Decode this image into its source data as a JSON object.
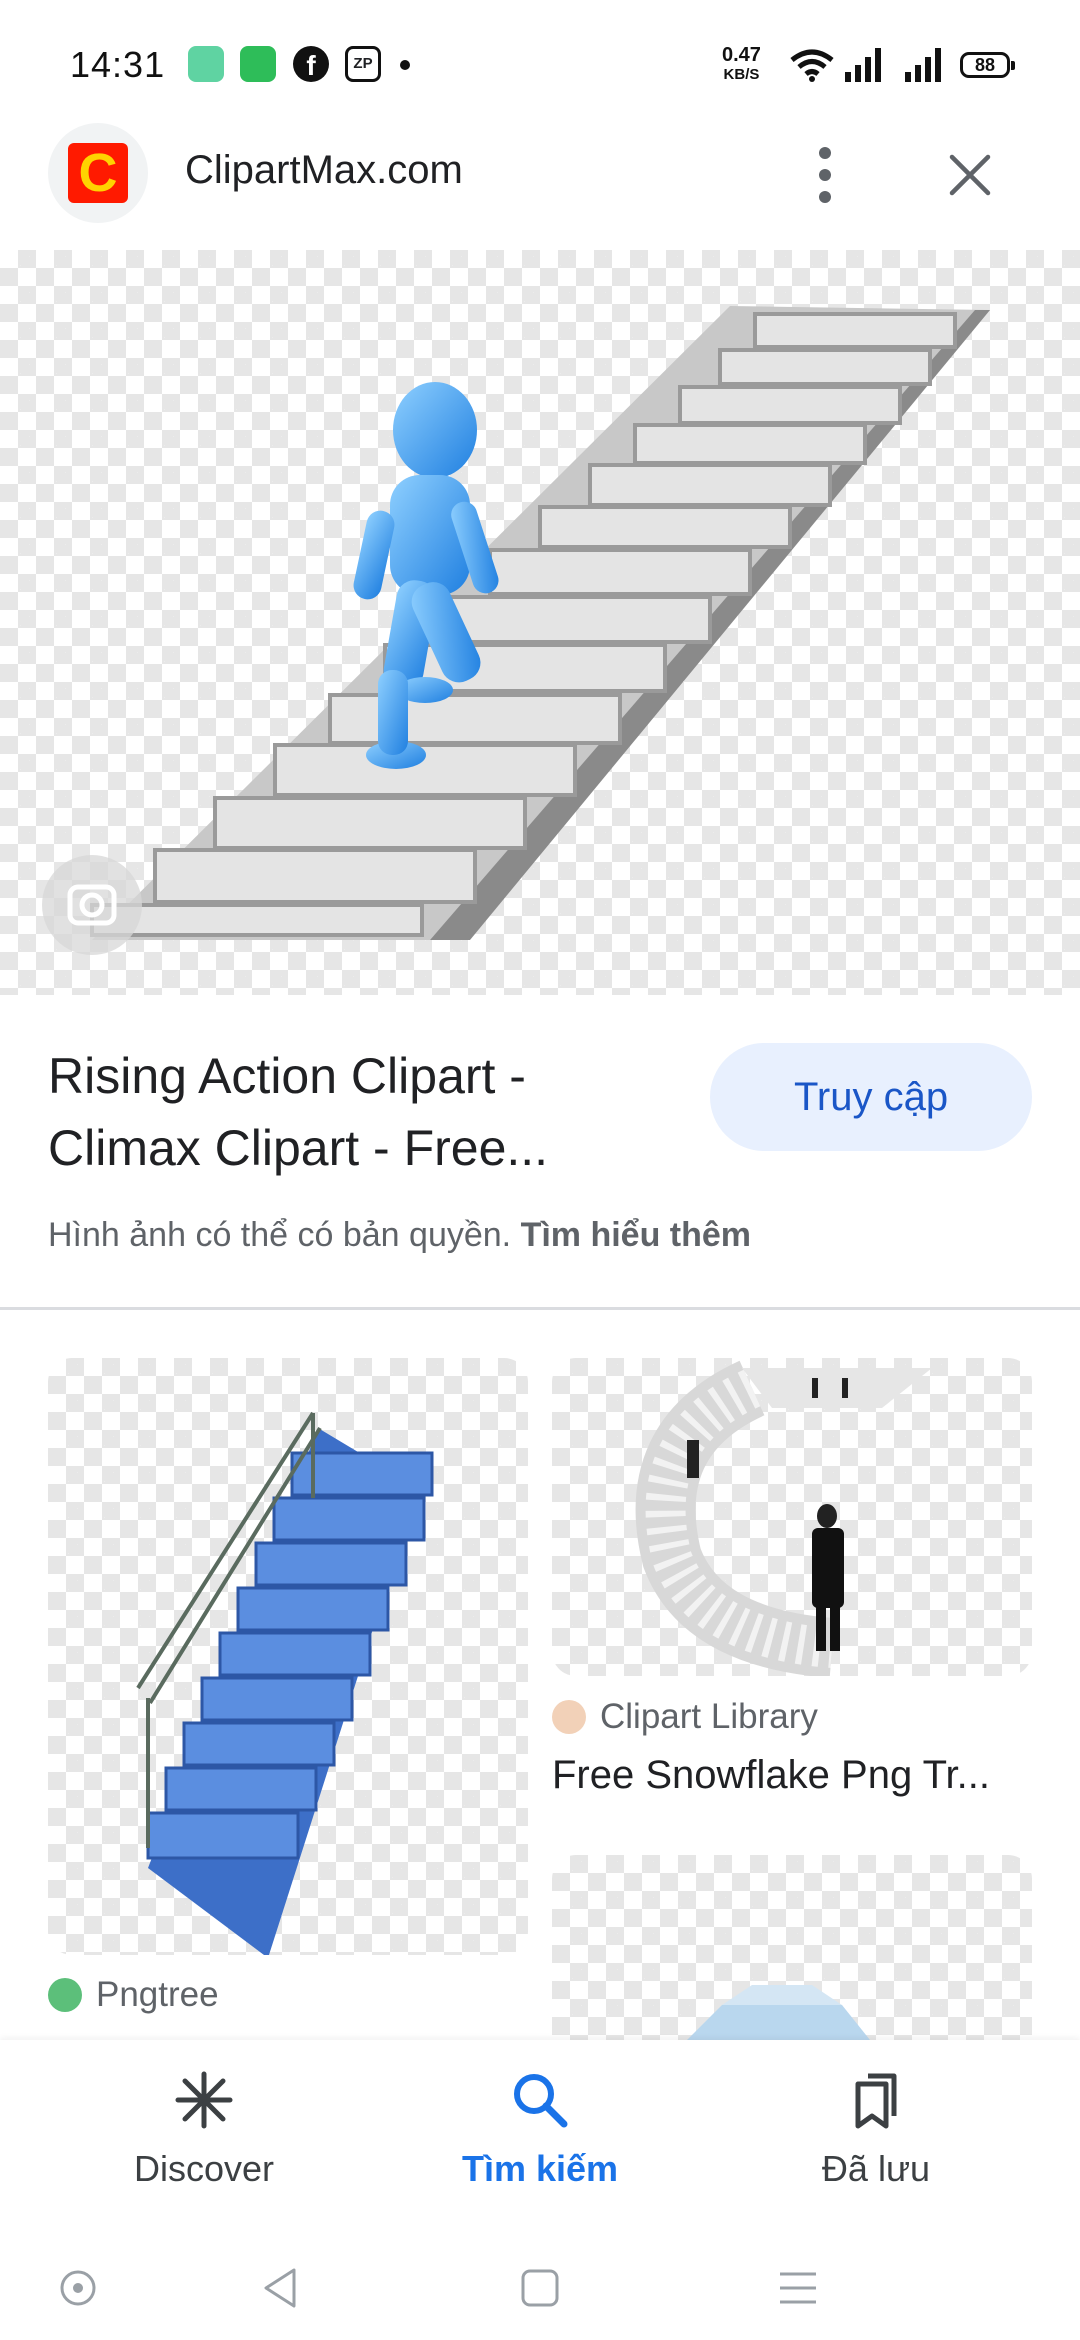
{
  "status_bar": {
    "time": "14:31",
    "net_speed": "0.47",
    "net_unit": "KB/S",
    "battery": "88"
  },
  "header": {
    "site_name": "ClipartMax.com",
    "logo_letter": "C"
  },
  "result": {
    "title_line1": "Rising Action Clipart -",
    "title_line2": "Climax Clipart - Free...",
    "visit_label": "Truy cập",
    "copyright_text": "Hình ảnh có thể có bản quyền.",
    "learn_more": "Tìm hiểu thêm"
  },
  "related": [
    {
      "source": "Pngtree"
    },
    {
      "source": "Clipart Library",
      "title": "Free Snowflake Png Tr..."
    }
  ],
  "bottom_nav": {
    "items": [
      {
        "label": "Discover",
        "icon": "asterisk-icon",
        "active": false
      },
      {
        "label": "Tìm kiếm",
        "icon": "search-icon",
        "active": true
      },
      {
        "label": "Đã lưu",
        "icon": "bookmarks-icon",
        "active": false
      }
    ]
  },
  "colors": {
    "accent": "#1a73e8",
    "visit_bg": "#e8f0fe",
    "logo_red": "#ff1a00",
    "logo_yellow": "#ffd400"
  }
}
